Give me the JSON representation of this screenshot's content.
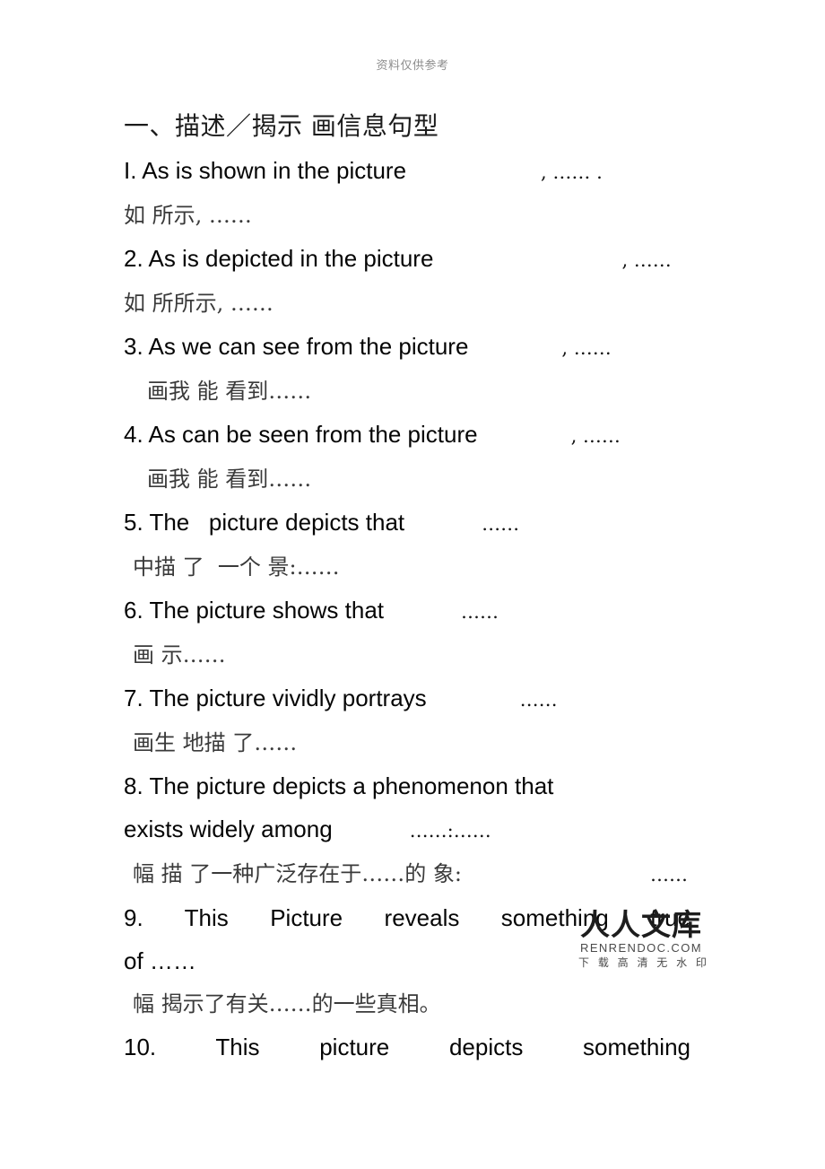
{
  "header": {
    "note": "资料仅供参考"
  },
  "document": {
    "section_title": "一、描述／揭示 画信息句型"
  },
  "items": [
    {
      "en_prefix": "I. As is shown in the picture",
      "en_suffix": ", …… .",
      "cn": "如 所示, ……"
    },
    {
      "en_prefix": "2. As is depicted in the picture",
      "en_suffix": ", ……",
      "cn": "如 所所示, ……"
    },
    {
      "en_prefix": "3. As we can see from the picture",
      "en_suffix": ", ……",
      "cn": "画我 能 看到……"
    },
    {
      "en_prefix": "4. As can be seen from the picture",
      "en_suffix": ", ……",
      "cn": "画我 能 看到……"
    },
    {
      "en_prefix": "5. The   picture depicts that",
      "en_suffix": "……",
      "cn": "中描 了  一个 景:……"
    },
    {
      "en_prefix": "6. The picture shows that",
      "en_suffix": "……",
      "cn": "画 示……"
    },
    {
      "en_prefix": "7. The picture vividly portrays",
      "en_suffix": "……",
      "cn": "画生 地描 了……"
    },
    {
      "en_line1": "8. The picture depicts a phenomenon that",
      "en_prefix": "exists widely among",
      "en_suffix": "……:……",
      "cn": "幅 描 了一种广泛存在于……的 象:",
      "cn_tail": "……"
    },
    {
      "en_line1": "9.  This  Picture  reveals  something  true",
      "en_prefix": "of ……",
      "cn": "幅 揭示了有关……的一些真相。"
    },
    {
      "en_line1": "10.  This  picture  depicts  something"
    }
  ],
  "watermark": {
    "brand": "人人文库",
    "url": "RENRENDOC.COM",
    "subtitle": "下 载 高 清 无 水 印"
  }
}
